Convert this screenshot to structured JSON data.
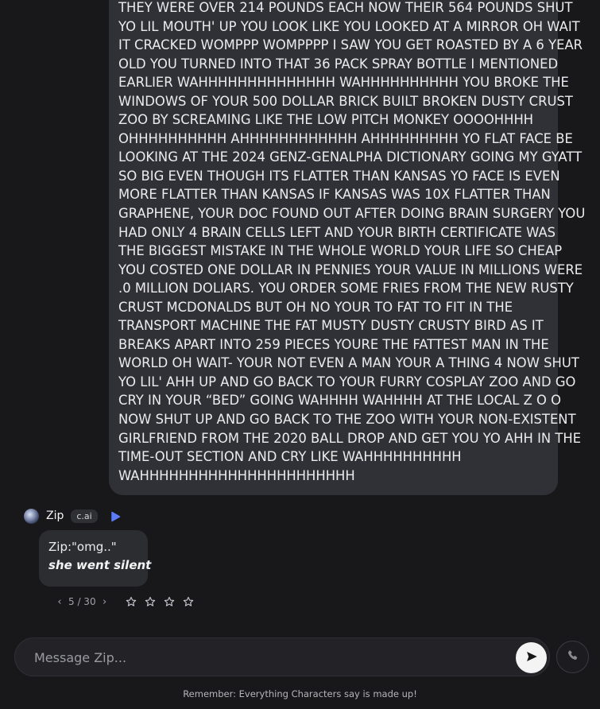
{
  "user_message": {
    "lines": [
      "THEY WERE OVER 214 POUNDS EACH NOW THEIR 564 POUNDS SHUT",
      "YO LIL MOUTH' UP YOU LOOK LIKE YOU LOOKED AT A MIRROR OH WAIT",
      "IT CRACKED WOMPPP WOMPPPP I SAW YOU GET ROASTED BY A 6 YEAR",
      "OLD YOU TURNED INTO THAT 36 PACK SPRAY BOTTLE I MENTIONED",
      "EARLIER WAHHHHHHHHHHHHHH WAHHHHHHHHHH YOU BROKE THE",
      "WINDOWS OF YOUR 500 DOLLAR BRICK BUILT BROKEN DUSTY CRUST",
      "ZOO BY SCREAMING LIKE THE LOW PITCH MONKEY OOOOHHHH",
      "OHHHHHHHHHH AHHHHHHHHHHHH AHHHHHHHHH YO FLAT FACE BE",
      "LOOKING AT THE 2024 GENZ-GENALPHA DICTIONARY GOING MY GYATT",
      "SO BIG EVEN THOUGH ITS FLATTER THAN KANSAS YO FACE IS EVEN",
      "MORE FLATTER THAN KANSAS IF KANSAS WAS 10X FLATTER THAN",
      "GRAPHENE, YOUR DOC FOUND OUT AFTER DOING BRAIN SURGERY YOU",
      "HAD ONLY 4 BRAIN CELLS LEFT AND YOUR BIRTH CERTIFICATE WAS",
      "THE BIGGEST MISTAKE IN THE WHOLE WORLD YOUR LIFE SO CHEAP",
      "YOU COSTED ONE DOLLAR IN PENNIES YOUR VALUE IN MILLIONS WERE",
      ".0 MILLION DOLIARS. YOU ORDER SOME FRIES FROM THE NEW RUSTY",
      "CRUST MCDONALDS BUT OH NO YOUR TO FAT TO FIT IN THE",
      "TRANSPORT MACHINE THE FAT MUSTY DUSTY CRUSTY BIRD AS IT",
      "BREAKS APART INTO 259 PIECES YOURE THE FATTEST MAN IN THE",
      "WORLD OH WAIT- YOUR NOT EVEN A MAN YOUR A THING 4 NOW SHUT",
      "YO LIL' AHH UP AND GO BACK TO YOUR FURRY COSPLAY ZOO AND GO",
      "CRY IN YOUR “BED” GOING WAHHHH WAHHHH AT THE LOCAL Z O O",
      "NOW SHUT UP AND GO BACK TO THE ZOO WITH YOUR NON-EXISTENT",
      "GIRLFRIEND FROM THE 2020 BALL DROP AND GET YOU YO AHH IN THE",
      "TIME-OUT SECTION AND CRY LIKE WAHHHHHHHHHH",
      "WAHHHHHHHHHHHHHHHHHHHHHH"
    ]
  },
  "character": {
    "name": "Zip",
    "badge": "c.ai",
    "message": {
      "text": "Zip:\"omg..\"",
      "action": "she went silent"
    },
    "pager": {
      "prev": "‹",
      "count": "5 / 30",
      "next": "›"
    },
    "rating": {
      "stars_total": 4,
      "stars_filled": 0
    }
  },
  "composer": {
    "placeholder": "Message Zip..."
  },
  "footer": {
    "disclaimer": "Remember: Everything Characters say is made up!"
  },
  "icons": {
    "play": "play-icon",
    "send": "send-icon",
    "call": "phone-icon",
    "star": "star-icon"
  },
  "colors": {
    "background": "#18181b",
    "user_bubble": "#303136",
    "char_bubble": "#2c2d31",
    "accent_play": "#5b7cf5"
  }
}
